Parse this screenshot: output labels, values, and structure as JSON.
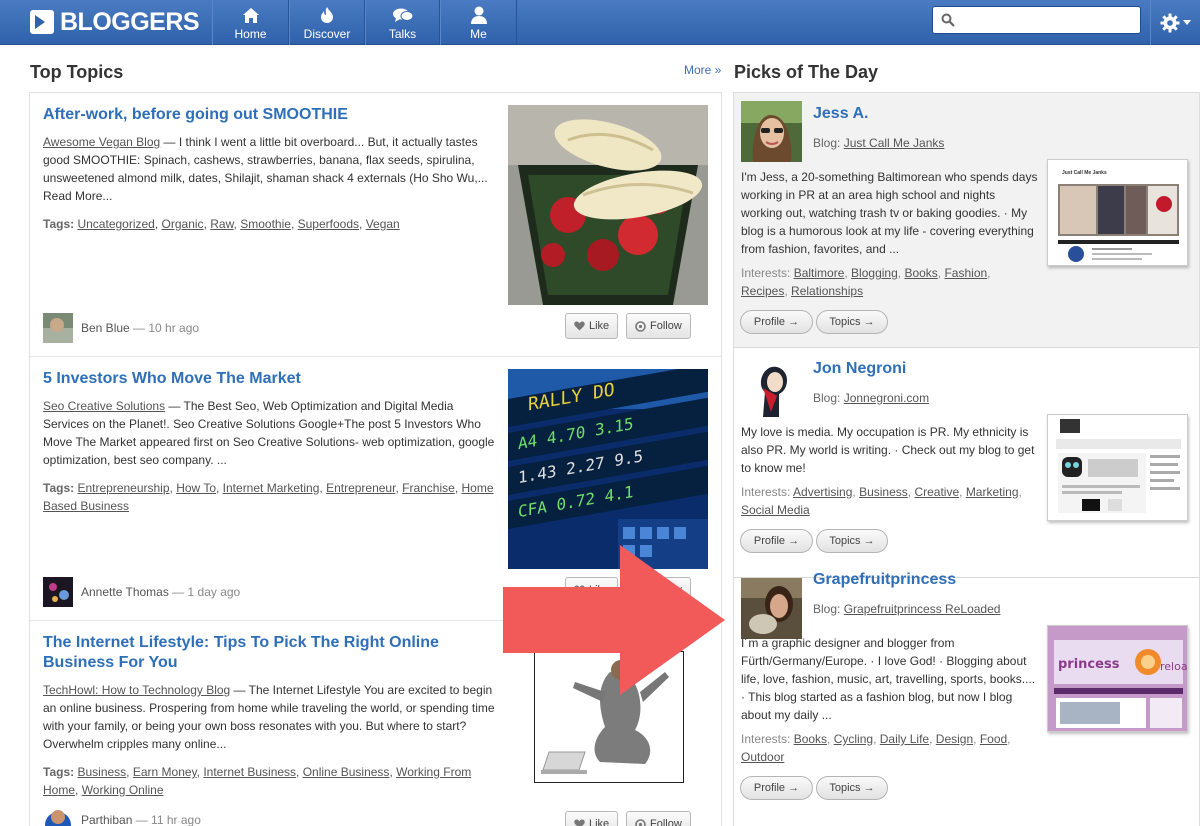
{
  "nav": {
    "logo": "BLOGGERS",
    "items": [
      {
        "label": "Home",
        "icon": "home-icon"
      },
      {
        "label": "Discover",
        "icon": "flame-icon"
      },
      {
        "label": "Talks",
        "icon": "chat-icon"
      },
      {
        "label": "Me",
        "icon": "user-icon"
      }
    ],
    "search_value": "",
    "search_placeholder": ""
  },
  "top_topics": {
    "title": "Top Topics",
    "more": "More »",
    "posts": [
      {
        "title": "After-work, before going out SMOOTHIE",
        "blog": "Awesome Vegan Blog",
        "excerpt": " — I think I went a little bit overboard... But, it actually tastes good SMOOTHIE: Spinach, cashews, strawberries, banana, flax seeds, spirulina, unsweetened almond milk, dates, Shilajit, shaman shack 4 externals (Ho Sho Wu,... Read More...",
        "tags_label": "Tags:",
        "tags": [
          "Uncategorized",
          "Organic",
          "Raw",
          "Smoothie",
          "Superfoods",
          "Vegan"
        ],
        "author": "Ben Blue",
        "time": "10 hr ago"
      },
      {
        "title": "5 Investors Who Move The Market",
        "blog": "Seo Creative Solutions",
        "excerpt": " — The Best Seo, Web Optimization and Digital Media Services on the Planet!. Seo Creative Solutions Google+The post 5 Investors Who Move The Market appeared first on Seo Creative Solutions- web optimization, google optimization, best seo company. ...",
        "tags_label": "Tags:",
        "tags": [
          "Entrepreneurship",
          "How To",
          "Internet Marketing",
          "Entrepreneur",
          "Franchise",
          "Home Based Business"
        ],
        "author": "Annette Thomas",
        "time": "1 day ago"
      },
      {
        "title": "The Internet Lifestyle: Tips To Pick The Right Online Business For You",
        "blog": "TechHowl: How to Technology Blog",
        "excerpt": " — The Internet Lifestyle You are excited to begin an online business. Prospering from home while traveling the world, or spending time with your family, or being your own boss resonates with you. But where to start? Overwhelm cripples many online...",
        "tags_label": "Tags:",
        "tags": [
          "Business",
          "Earn Money",
          "Internet Business",
          "Online Business",
          "Working From Home",
          "Working Online"
        ],
        "author": "Parthiban",
        "time": "11 hr ago"
      }
    ],
    "like_label": "Like",
    "follow_label": "Follow"
  },
  "picks": {
    "title": "Picks of The Day",
    "blog_prefix": "Blog: ",
    "interests_prefix": "Interests: ",
    "profile_label": "Profile →",
    "topics_label": "Topics →",
    "items": [
      {
        "name": "Jess A.",
        "blog": "Just Call Me Janks",
        "bio": "I'm Jess, a 20-something Baltimorean who spends days working in PR at an area high school and nights working out, watching trash tv or baking goodies. · My blog is a humorous look at my life - covering everything from fashion, favorites, and ...",
        "interests": [
          "Baltimore",
          "Blogging",
          "Books",
          "Fashion",
          "Recipes",
          "Relationships"
        ],
        "shot_title": "Just Call Me Janks"
      },
      {
        "name": "Jon Negroni",
        "blog": "Jonnegroni.com",
        "bio": "My love is media. My occupation is PR. My ethnicity is also PR. My world is writing. · Check out my blog to get to know me!",
        "interests": [
          "Advertising",
          "Business",
          "Creative",
          "Marketing",
          "Social Media"
        ],
        "shot_title": ""
      },
      {
        "name": "Grapefruitprincess",
        "blog": "Grapefruitprincess ReLoaded",
        "bio": "I´m a graphic designer and blogger from Fürth/Germany/Europe. · I love God! · Blogging about life, love, fashion, music, art, travelling, sports, books.... · This blog started as a fashion blog, but now I blog about my daily ...",
        "interests": [
          "Books",
          "Cycling",
          "Daily Life",
          "Design",
          "Food",
          "Outdoor"
        ],
        "shot_title": ""
      }
    ]
  },
  "colors": {
    "nav_bg": "#3a6db6",
    "link": "#2e6fb8",
    "arrow": "#f25a5a"
  }
}
